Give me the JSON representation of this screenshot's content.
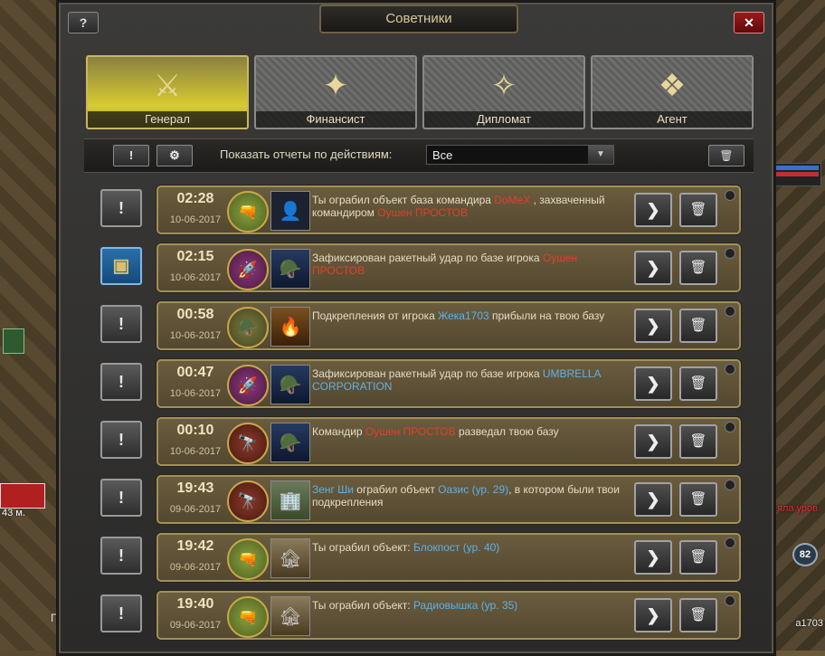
{
  "window": {
    "title": "Советники",
    "help_label": "?",
    "close_label": "✕"
  },
  "tabs": [
    {
      "label": "Генерал",
      "icon": "tank-emblem-icon",
      "glyph": "⚔"
    },
    {
      "label": "Финансист",
      "icon": "money-emblem-icon",
      "glyph": "✦"
    },
    {
      "label": "Дипломат",
      "icon": "handshake-emblem-icon",
      "glyph": "✧"
    },
    {
      "label": "Агент",
      "icon": "laptop-emblem-icon",
      "glyph": "❖"
    }
  ],
  "filter": {
    "alert_label": "!",
    "settings_label": "⚙",
    "label": "Показать отчеты по действиям:",
    "selected": "Все",
    "dropdown_arrow": "▼",
    "trash_label": "🗑"
  },
  "reports": [
    {
      "time": "02:28",
      "date": "10-06-2017",
      "side": "!",
      "medal": "green",
      "parts": [
        {
          "t": "Ты ограбил объект база командира "
        },
        {
          "t": "DoMeX",
          "c": "red"
        },
        {
          "t": " , захваченный командиром "
        },
        {
          "t": "Оушен ПРОСТОВ",
          "c": "red"
        }
      ]
    },
    {
      "time": "02:15",
      "date": "10-06-2017",
      "side": "ammo",
      "medal": "purple",
      "parts": [
        {
          "t": "Зафиксирован ракетный удар по базе игрока "
        },
        {
          "t": "Оушен ПРОСТОВ",
          "c": "red"
        }
      ]
    },
    {
      "time": "00:58",
      "date": "10-06-2017",
      "side": "!",
      "medal": "olive",
      "parts": [
        {
          "t": "Подкрепления от игрока "
        },
        {
          "t": "Жека1703",
          "c": "blue"
        },
        {
          "t": " прибыли на твою базу"
        }
      ]
    },
    {
      "time": "00:47",
      "date": "10-06-2017",
      "side": "!",
      "medal": "purple",
      "parts": [
        {
          "t": "Зафиксирован ракетный удар по базе игрока "
        },
        {
          "t": "UMBRELLA CORPORATION",
          "c": "blue"
        }
      ]
    },
    {
      "time": "00:10",
      "date": "10-06-2017",
      "side": "!",
      "medal": "red",
      "parts": [
        {
          "t": "Командир "
        },
        {
          "t": "Оушен ПРОСТОВ",
          "c": "red"
        },
        {
          "t": " разведал твою базу"
        }
      ]
    },
    {
      "time": "19:43",
      "date": "09-06-2017",
      "side": "!",
      "medal": "red",
      "parts": [
        {
          "t": "Зенг Ши",
          "c": "blue"
        },
        {
          "t": " ограбил объект "
        },
        {
          "t": "Оазис (ур. 29)",
          "c": "blue"
        },
        {
          "t": ", в котором были твои подкрепления"
        }
      ]
    },
    {
      "time": "19:42",
      "date": "09-06-2017",
      "side": "!",
      "medal": "green",
      "parts": [
        {
          "t": "Ты ограбил объект: "
        },
        {
          "t": "Блокпост (ур. 40)",
          "c": "blue"
        }
      ]
    },
    {
      "time": "19:40",
      "date": "09-06-2017",
      "side": "!",
      "medal": "green",
      "parts": [
        {
          "t": "Ты ограбил объект: "
        },
        {
          "t": "Радиовышка (ур. 35)",
          "c": "blue"
        }
      ]
    }
  ],
  "avatars": [
    "dark",
    "soldier",
    "fire",
    "soldier",
    "soldier",
    "building",
    "ruins",
    "ruins"
  ],
  "row_actions": {
    "go_label": "❯",
    "delete_label": "🗑"
  },
  "background": {
    "distance": "43 м.",
    "level": "82",
    "player": "a1703",
    "tag": "няла уров",
    "partial": "П"
  }
}
